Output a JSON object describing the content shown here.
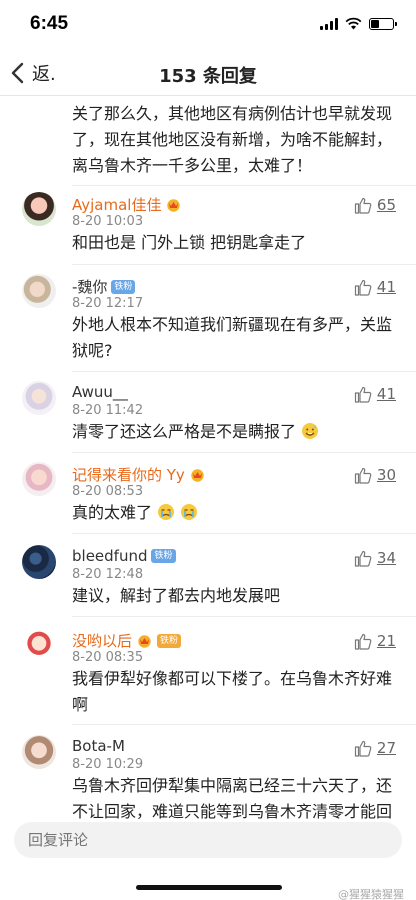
{
  "status_bar": {
    "time": "6:45"
  },
  "nav": {
    "back_label": "返.",
    "title": "153 条回复"
  },
  "partial_comment": {
    "text": "关了那么久，其他地区有病例估计也早就发现了，现在其他地区没有新增，为啥不能解封，离乌鲁木齐一千多公里，太难了！"
  },
  "comments": [
    {
      "user": "Ayjamal佳佳",
      "time": "8-20 10:03",
      "text": "和田也是 门外上锁 把钥匙拿走了",
      "likes": "65"
    },
    {
      "user": "-魏你",
      "badge": "铁粉",
      "time": "8-20 12:17",
      "text": "外地人根本不知道我们新疆现在有多严，关监狱呢?",
      "likes": "41"
    },
    {
      "user": "Awuu__",
      "time": "8-20 11:42",
      "text": "清零了还这么严格是不是瞒报了",
      "likes": "41"
    },
    {
      "user": "记得来看你的 Yy",
      "time": "8-20 08:53",
      "text": "真的太难了",
      "likes": "30"
    },
    {
      "user": "bleedfund",
      "badge": "铁粉",
      "time": "8-20 12:48",
      "text": "建议，解封了都去内地发展吧",
      "likes": "34"
    },
    {
      "user": "没哟以后",
      "badge": "铁粉",
      "time": "8-20 08:35",
      "text": "我看伊犁好像都可以下楼了。在乌鲁木齐好难啊",
      "likes": "21"
    },
    {
      "user": "Bota-M",
      "time": "8-20 10:29",
      "text": "乌鲁木齐回伊犁集中隔离已经三十六天了，还不让回家，难道只能等到乌鲁木齐清零才能回",
      "likes": "27"
    }
  ],
  "reply_box": {
    "placeholder": "回复评论"
  },
  "watermark": "@猩猩猿猩猩"
}
